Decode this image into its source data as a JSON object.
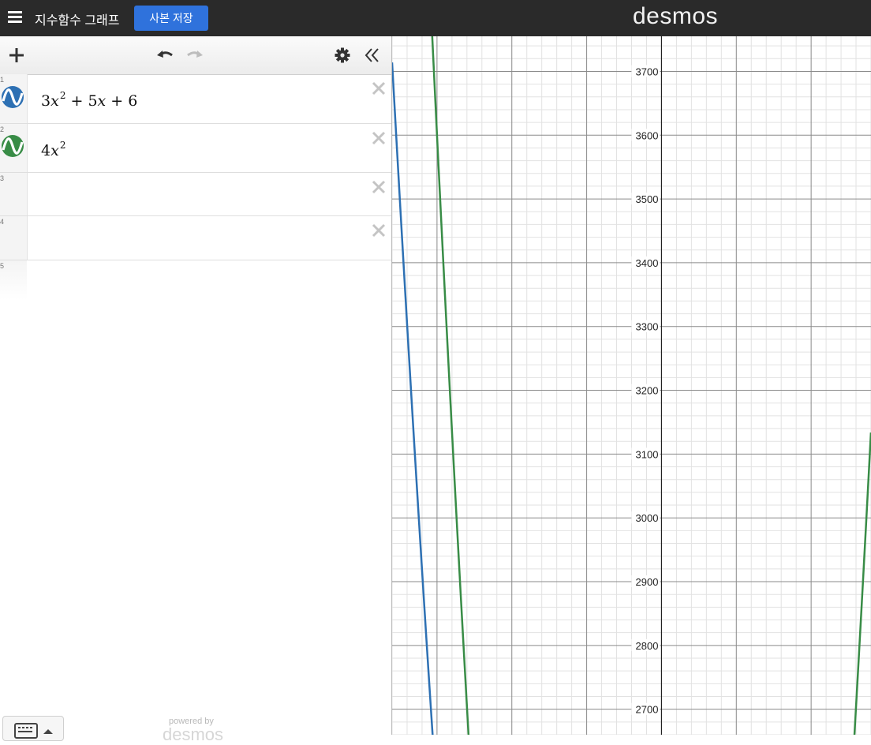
{
  "header": {
    "menu_icon": "hamburger-icon",
    "title": "지수함수 그래프",
    "save_button": "사본 저장",
    "brand": "desmos"
  },
  "toolbar": {
    "add_icon": "plus-icon",
    "undo_icon": "undo-icon",
    "redo_icon": "redo-icon",
    "settings_icon": "gear-icon",
    "collapse_icon": "double-chevron-left-icon"
  },
  "expressions": [
    {
      "num": "1",
      "latex": "3x^2+5x+6",
      "color": "#2d70b3",
      "icon": "graph-wave-icon"
    },
    {
      "num": "2",
      "latex": "4x^2",
      "color": "#388c46",
      "icon": "graph-wave-icon"
    },
    {
      "num": "3",
      "latex": ""
    },
    {
      "num": "4",
      "latex": ""
    },
    {
      "num": "5",
      "latex": ""
    }
  ],
  "footer": {
    "powered_by": "powered by",
    "logo": "desmos",
    "keyboard_icon": "keyboard-icon"
  },
  "graph": {
    "y_ticks": [
      "3700",
      "3600",
      "3500",
      "3400",
      "3300",
      "3200",
      "3100",
      "3000",
      "2900",
      "2800",
      "2700"
    ],
    "curve_colors": {
      "blue": "#2d70b3",
      "green": "#388c46"
    }
  },
  "chart_data": {
    "type": "line",
    "title": "",
    "xlabel": "",
    "ylabel": "",
    "xlim": [
      -36,
      28
    ],
    "ylim": [
      2660,
      3755
    ],
    "grid": true,
    "y_ticks": [
      2700,
      2800,
      2900,
      3000,
      3100,
      3200,
      3300,
      3400,
      3500,
      3600,
      3700
    ],
    "series": [
      {
        "expression": "3x^2+5x+6",
        "color": "#2d70b3"
      },
      {
        "expression": "4x^2",
        "color": "#388c46"
      }
    ]
  }
}
